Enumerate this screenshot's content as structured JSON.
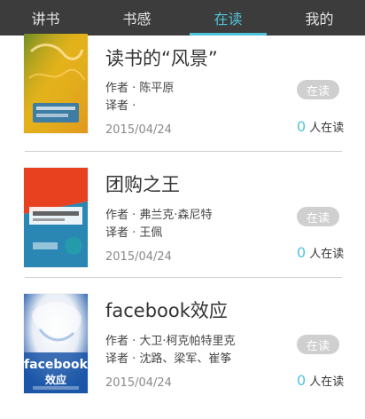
{
  "tabs": [
    {
      "label": "讲书"
    },
    {
      "label": "书感"
    },
    {
      "label": "在读",
      "active": true
    },
    {
      "label": "我的"
    }
  ],
  "books": [
    {
      "title": "读书的“风景”",
      "author": "作者 · 陈平原",
      "translator": "译者 ·",
      "date": "2015/04/24",
      "status": "在读",
      "reading_count": "0",
      "reading_label": "人在读",
      "cover_colors": [
        "#e3b21b",
        "#4b8a2e",
        "#e08a1e",
        "#2c78b4"
      ]
    },
    {
      "title": "团购之王",
      "author": "作者 · 弗兰克·森尼特",
      "translator": "译者 · 王佩",
      "date": "2015/04/24",
      "status": "在读",
      "reading_count": "0",
      "reading_label": "人在读",
      "cover_colors": [
        "#e8411f",
        "#1f7fb0",
        "#f3f0e8",
        "#23a0a8"
      ]
    },
    {
      "title": "facebook效应",
      "author": "作者 · 大卫·柯克帕特里克",
      "translator": "译者 · 沈路、梁军、崔筝",
      "date": "2015/04/24",
      "status": "在读",
      "reading_count": "0",
      "reading_label": "人在读",
      "cover_colors": [
        "#1b56a8",
        "#e9eef6",
        "#ffffff",
        "#2b6cc0"
      ],
      "cover_text": [
        "facebook",
        "效应"
      ]
    }
  ],
  "icons": {
    "cover1": "book-cover-image",
    "cover2": "book-cover-image",
    "cover3": "book-cover-image"
  }
}
